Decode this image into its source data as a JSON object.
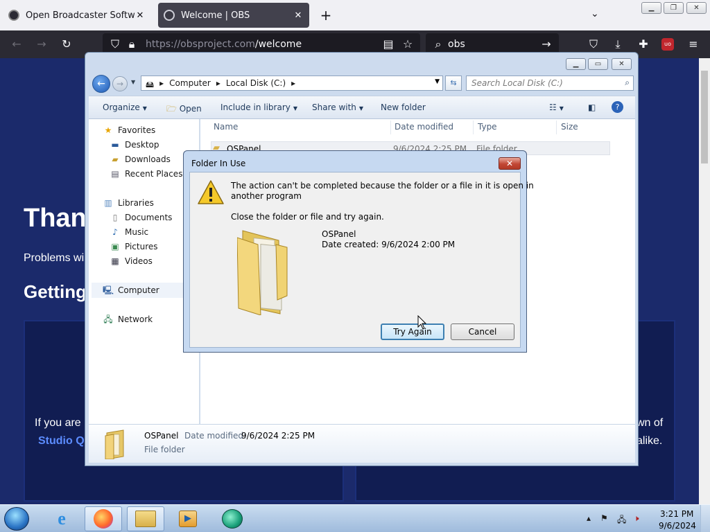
{
  "browser": {
    "tabs": [
      {
        "title": "Open Broadcaster Software | OB",
        "active": false
      },
      {
        "title": "Welcome | OBS",
        "active": true
      }
    ],
    "url_host": "https://obsproject.com",
    "url_path": "/welcome",
    "search_text": "obs",
    "new_tab_label": "+"
  },
  "web": {
    "heading_partial": "Than",
    "problems_partial": "Problems wi",
    "getting_partial": "Getting",
    "if_you_partial": "If you are",
    "studio_partial": "Studio Q",
    "wn_of_partial": "wn of",
    "alike_partial": "alike."
  },
  "explorer": {
    "breadcrumb": [
      "Computer",
      "Local Disk (C:)"
    ],
    "search_placeholder": "Search Local Disk (C:)",
    "toolbar": {
      "organize": "Organize",
      "open": "Open",
      "include": "Include in library",
      "share": "Share with",
      "newfolder": "New folder"
    },
    "nav": {
      "favorites": "Favorites",
      "desktop": "Desktop",
      "downloads": "Downloads",
      "recent": "Recent Places",
      "libraries": "Libraries",
      "documents": "Documents",
      "music": "Music",
      "pictures": "Pictures",
      "videos": "Videos",
      "computer": "Computer",
      "network": "Network"
    },
    "columns": {
      "name": "Name",
      "date": "Date modified",
      "type": "Type",
      "size": "Size"
    },
    "row": {
      "name": "OSPanel",
      "date": "9/6/2024 2:25 PM",
      "type": "File folder"
    },
    "details": {
      "name": "OSPanel",
      "date_label": "Date modified:",
      "date_value": "9/6/2024 2:25 PM",
      "type": "File folder"
    }
  },
  "dialog": {
    "title": "Folder In Use",
    "message_line1": "The action can't be completed because the folder or a file in it is open in",
    "message_line2": "another program",
    "instruction": "Close the folder or file and try again.",
    "item_name": "OSPanel",
    "item_created": "Date created: 9/6/2024 2:00 PM",
    "try_again": "Try Again",
    "cancel": "Cancel"
  },
  "taskbar": {
    "time": "3:21 PM",
    "date": "9/6/2024"
  },
  "colors": {
    "web_bg": "#1b2a6b",
    "dialog_frame": "#c6d9f1",
    "close_red": "#c24734"
  }
}
